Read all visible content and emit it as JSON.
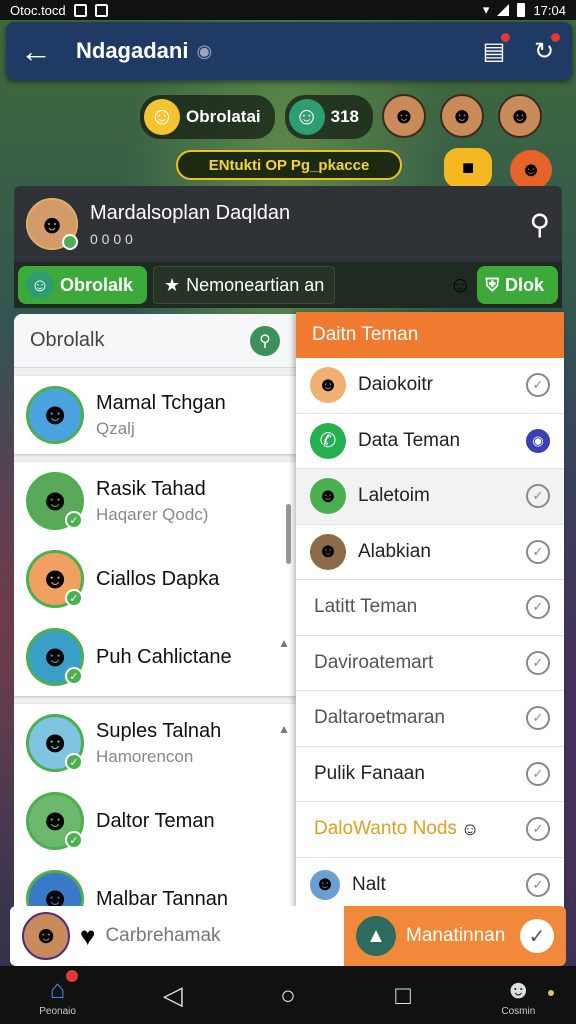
{
  "status_bar": {
    "left_text": "Otoc.tocd",
    "time": "17:04"
  },
  "header": {
    "back_icon": "arrow-left-icon",
    "title": "Ndagadani"
  },
  "game_stats": {
    "pill1_label": "Obrolatai",
    "pill2_value": "318"
  },
  "banner": {
    "text": "ENtukti OP Pg_pkacce"
  },
  "profile": {
    "name": "Mardalsoplan Daqldan",
    "sub": "0 0 0 0"
  },
  "tabs": {
    "tab1": "Obrolalk",
    "tab2": "Nemoneartian an",
    "tab3": "Dlok"
  },
  "left_panel": {
    "title": "Obrolalk",
    "contacts": [
      {
        "name": "Mamal Tchgan",
        "sub": "Qzalj"
      },
      {
        "name": "Rasik Tahad",
        "sub": "Haqarer Qodc)"
      },
      {
        "name": "Ciallos Dapka",
        "sub": ""
      },
      {
        "name": "Puh Cahlictane",
        "sub": ""
      },
      {
        "name": "Suples Talnah",
        "sub": "Hamorencon"
      },
      {
        "name": "Daltor Teman",
        "sub": ""
      },
      {
        "name": "Malbar Tannan",
        "sub": ""
      }
    ]
  },
  "right_panel": {
    "title": "Daitn Teman",
    "friends": [
      {
        "name": "Daiokoitr",
        "color": "#222222"
      },
      {
        "name": "Data Teman",
        "color": "#222222"
      },
      {
        "name": "Laletoim",
        "color": "#222222"
      },
      {
        "name": "Alabkian",
        "color": "#222222"
      },
      {
        "name": "Latitt Teman",
        "color": "#555555"
      },
      {
        "name": "Daviroatemart",
        "color": "#555555"
      },
      {
        "name": "Daltaroetmaran",
        "color": "#555555"
      },
      {
        "name": "Pulik Fanaan",
        "color": "#222222"
      },
      {
        "name": "DaloWanto Nods",
        "color": "#e0a020"
      },
      {
        "name": "Nalt",
        "color": "#222222"
      }
    ]
  },
  "action_bar": {
    "input_text": "Carbrehamak",
    "button_label": "Manatinnan"
  },
  "nav": {
    "home_label": "Peonaio",
    "profile_label": "Cosmin"
  },
  "colors": {
    "accent_orange": "#f07b30",
    "accent_green": "#3da93a",
    "header_blue": "#203a66"
  }
}
